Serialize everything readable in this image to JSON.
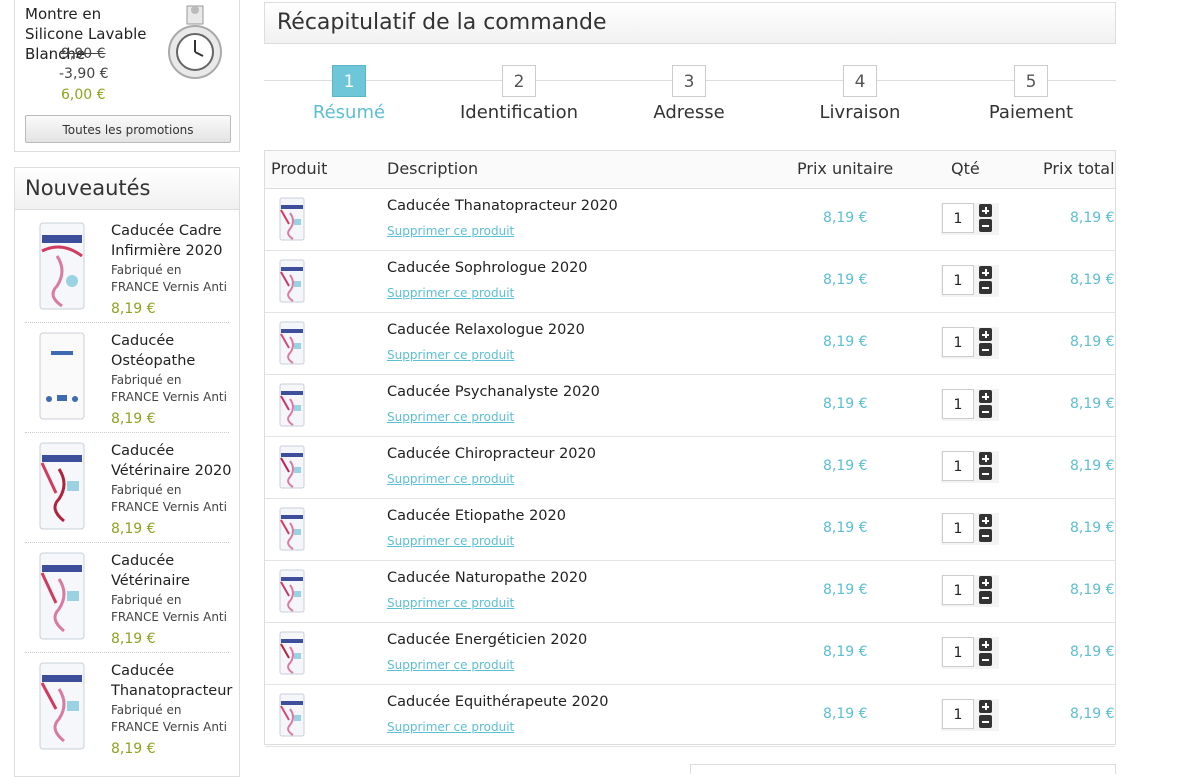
{
  "promo": {
    "title": "Montre en Silicone Lavable Blanche",
    "old_price": "9,90 €",
    "discount": "-3,90 €",
    "new_price": "6,00 €",
    "button": "Toutes les promotions"
  },
  "new_products": {
    "heading": "Nouveautés",
    "items": [
      {
        "name": "Caducée Cadre Infirmière 2020",
        "desc1": "Fabriqué en",
        "desc2": "FRANCE Vernis Anti",
        "price": "8,19 €"
      },
      {
        "name": "Caducée Ostéopathe",
        "desc1": "Fabriqué en",
        "desc2": "FRANCE Vernis Anti",
        "price": "8,19 €"
      },
      {
        "name": "Caducée Vétérinaire 2020",
        "desc1": "Fabriqué en",
        "desc2": "FRANCE Vernis Anti",
        "price": "8,19 €"
      },
      {
        "name": "Caducée Vétérinaire",
        "desc1": "Fabriqué en",
        "desc2": "FRANCE Vernis Anti",
        "price": "8,19 €"
      },
      {
        "name": "Caducée Thanatopracteur",
        "desc1": "Fabriqué en",
        "desc2": "FRANCE Vernis Anti",
        "price": "8,19 €"
      }
    ]
  },
  "page_title": "Récapitulatif de la commande",
  "steps": [
    {
      "num": "1",
      "label": "Résumé",
      "active": true
    },
    {
      "num": "2",
      "label": "Identification"
    },
    {
      "num": "3",
      "label": "Adresse"
    },
    {
      "num": "4",
      "label": "Livraison"
    },
    {
      "num": "5",
      "label": "Paiement"
    }
  ],
  "cart": {
    "headers": {
      "product": "Produit",
      "description": "Description",
      "unit_price": "Prix unitaire",
      "qty": "Qté",
      "total": "Prix total"
    },
    "remove_label": "Supprimer ce produit",
    "rows": [
      {
        "name": "Caducée Thanatopracteur 2020",
        "unit": "8,19 €",
        "qty": "1",
        "total": "8,19 €"
      },
      {
        "name": "Caducée Sophrologue 2020",
        "unit": "8,19 €",
        "qty": "1",
        "total": "8,19 €"
      },
      {
        "name": "Caducée Relaxologue 2020",
        "unit": "8,19 €",
        "qty": "1",
        "total": "8,19 €"
      },
      {
        "name": "Caducée Psychanalyste 2020",
        "unit": "8,19 €",
        "qty": "1",
        "total": "8,19 €"
      },
      {
        "name": "Caducée Chiropracteur 2020",
        "unit": "8,19 €",
        "qty": "1",
        "total": "8,19 €"
      },
      {
        "name": "Caducée Etiopathe 2020",
        "unit": "8,19 €",
        "qty": "1",
        "total": "8,19 €"
      },
      {
        "name": "Caducée Naturopathe 2020",
        "unit": "8,19 €",
        "qty": "1",
        "total": "8,19 €"
      },
      {
        "name": "Caducée Energéticien 2020",
        "unit": "8,19 €",
        "qty": "1",
        "total": "8,19 €"
      },
      {
        "name": "Caducée Equithérapeute 2020",
        "unit": "8,19 €",
        "qty": "1",
        "total": "8,19 €"
      }
    ]
  },
  "colors": {
    "accent": "#5bbfd4",
    "price_green": "#8aa51d"
  }
}
